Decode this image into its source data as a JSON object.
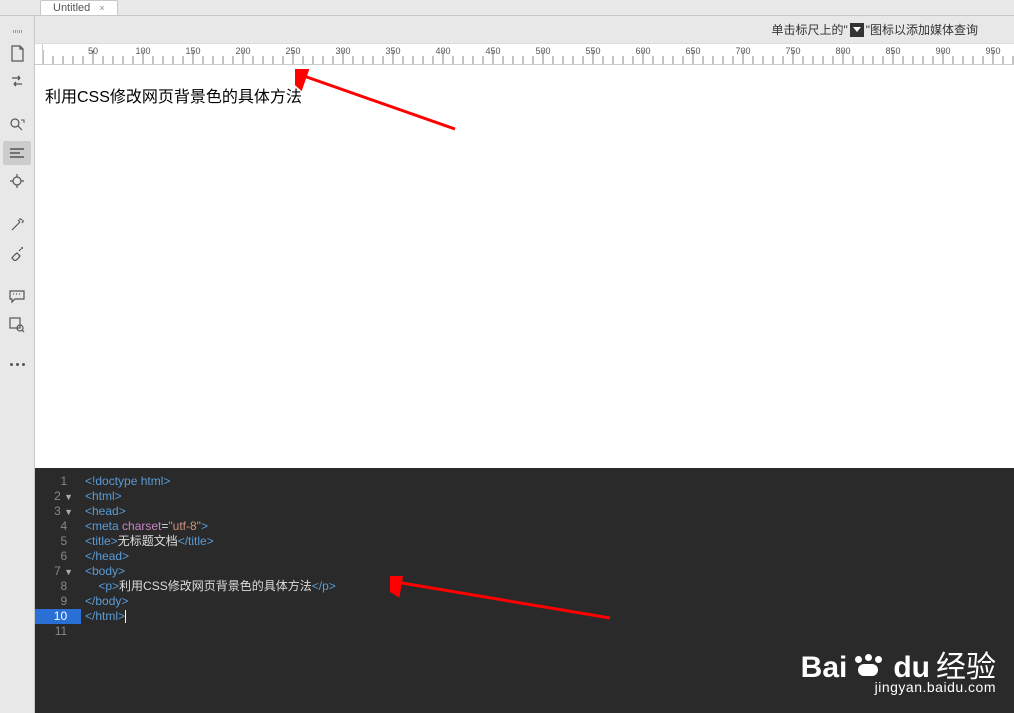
{
  "tab": {
    "title": "Untitled",
    "close": "×"
  },
  "hint": {
    "pre": "单击标尺上的\"",
    "post": "\"图标以添加媒体查询"
  },
  "ruler": {
    "ticks": [
      50,
      100,
      150,
      200,
      250,
      300,
      350,
      400,
      450,
      500,
      550,
      600,
      650,
      700,
      750,
      800,
      850,
      900,
      950
    ]
  },
  "preview": {
    "text": "利用CSS修改网页背景色的具体方法"
  },
  "code": {
    "lines": [
      {
        "n": 1,
        "fold": "",
        "html": "<span class='tok-tag'>&lt;!doctype html&gt;</span>"
      },
      {
        "n": 2,
        "fold": "▼",
        "html": "<span class='tok-tag'>&lt;html&gt;</span>"
      },
      {
        "n": 3,
        "fold": "▼",
        "html": "<span class='tok-tag'>&lt;head&gt;</span>"
      },
      {
        "n": 4,
        "fold": "",
        "html": "<span class='tok-tag'>&lt;meta</span> <span class='tok-attr'>charset</span>=<span class='tok-str'>\"utf-8\"</span><span class='tok-tag'>&gt;</span>"
      },
      {
        "n": 5,
        "fold": "",
        "html": "<span class='tok-tag'>&lt;title&gt;</span><span class='tok-txt'>无标题文档</span><span class='tok-tag'>&lt;/title&gt;</span>"
      },
      {
        "n": 6,
        "fold": "",
        "html": "<span class='tok-tag'>&lt;/head&gt;</span>"
      },
      {
        "n": 7,
        "fold": "▼",
        "html": "<span class='tok-tag'>&lt;body&gt;</span>"
      },
      {
        "n": 8,
        "fold": "",
        "html": "    <span class='tok-tag'>&lt;p&gt;</span><span class='tok-txt'>利用CSS修改网页背景色的具体方法</span><span class='tok-tag'>&lt;/p&gt;</span>"
      },
      {
        "n": 9,
        "fold": "",
        "html": "<span class='tok-tag'>&lt;/body&gt;</span>"
      },
      {
        "n": 10,
        "fold": "",
        "html": "<span class='tok-tag'>&lt;/html&gt;</span><span class='cursor-bar'></span>",
        "selected": true
      },
      {
        "n": 11,
        "fold": "",
        "html": ""
      }
    ]
  },
  "watermark": {
    "brand": "Bai",
    "brand2": "du",
    "brand3": "经验",
    "sub": "jingyan.baidu.com"
  }
}
